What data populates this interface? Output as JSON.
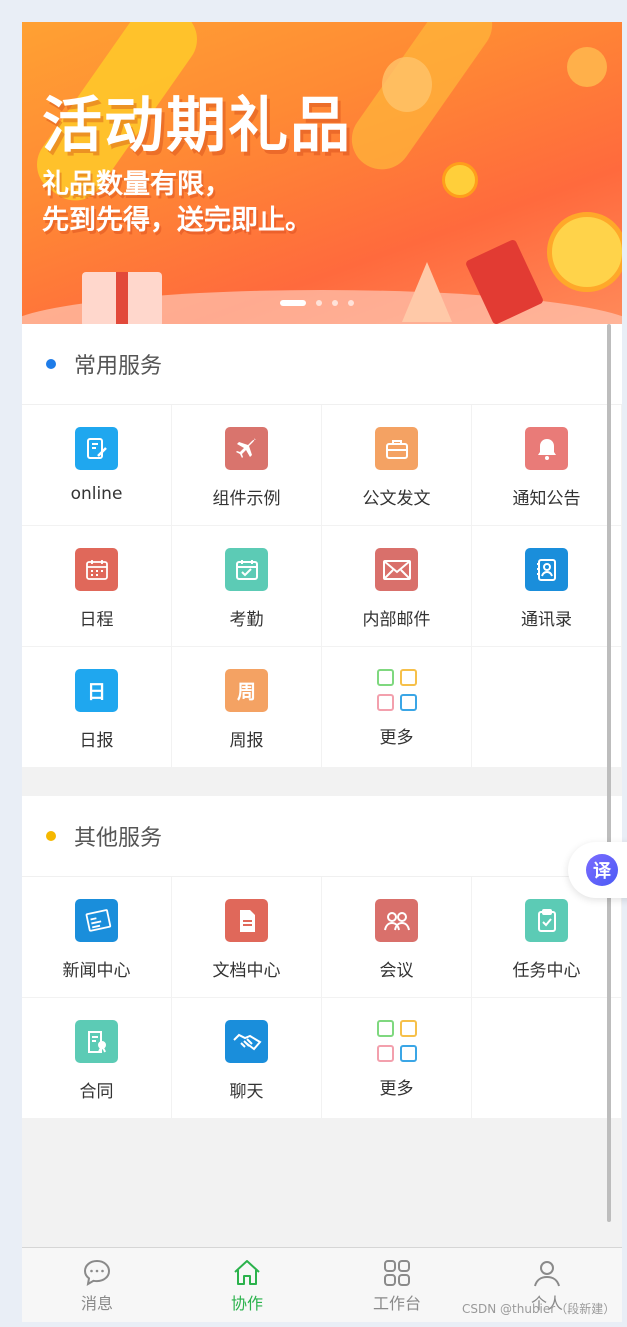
{
  "banner": {
    "title": "活动期礼品",
    "line1": "礼品数量有限，",
    "line2": "先到先得，送完即止。",
    "slides": 4,
    "active_slide": 1
  },
  "common": {
    "title": "常用服务",
    "bullet_color": "#1e7ce8",
    "items": [
      {
        "label": "online",
        "icon": "leave-note-icon",
        "color": "#1fa7ef"
      },
      {
        "label": "组件示例",
        "icon": "airplane-icon",
        "color": "#d9746d"
      },
      {
        "label": "公文发文",
        "icon": "briefcase-icon",
        "color": "#f4a263"
      },
      {
        "label": "通知公告",
        "icon": "bell-icon",
        "color": "#e97b78"
      },
      {
        "label": "日程",
        "icon": "calendar-icon",
        "color": "#e0685a"
      },
      {
        "label": "考勤",
        "icon": "check-calendar-icon",
        "color": "#5ccbb5"
      },
      {
        "label": "内部邮件",
        "icon": "mail-icon",
        "color": "#d9706b"
      },
      {
        "label": "通讯录",
        "icon": "contacts-icon",
        "color": "#1a8edb"
      },
      {
        "label": "日报",
        "icon": "daily-report-icon",
        "glyph": "日",
        "color": "#1fa7ef"
      },
      {
        "label": "周报",
        "icon": "weekly-report-icon",
        "glyph": "周",
        "color": "#f4a263"
      },
      {
        "label": "更多",
        "icon": "more-grid-icon"
      }
    ]
  },
  "other": {
    "title": "其他服务",
    "bullet_color": "#f5b800",
    "items": [
      {
        "label": "新闻中心",
        "icon": "news-icon",
        "color": "#1a8edb"
      },
      {
        "label": "文档中心",
        "icon": "document-icon",
        "color": "#e0685a"
      },
      {
        "label": "会议",
        "icon": "meeting-icon",
        "color": "#d9706b"
      },
      {
        "label": "任务中心",
        "icon": "task-icon",
        "color": "#5ccbb5"
      },
      {
        "label": "合同",
        "icon": "contract-icon",
        "color": "#5ccbb5"
      },
      {
        "label": "聊天",
        "icon": "handshake-icon",
        "color": "#1a8edb"
      },
      {
        "label": "更多",
        "icon": "more-grid-icon"
      }
    ]
  },
  "translate_button": {
    "glyph": "译"
  },
  "tabbar": {
    "active": "协作",
    "active_color": "#2bb24c",
    "tabs": [
      {
        "label": "消息",
        "icon": "chat-bubble-icon"
      },
      {
        "label": "协作",
        "icon": "home-icon"
      },
      {
        "label": "工作台",
        "icon": "grid-icon"
      },
      {
        "label": "个人",
        "icon": "user-icon"
      }
    ]
  },
  "watermark": "CSDN @thubier（段新建）"
}
